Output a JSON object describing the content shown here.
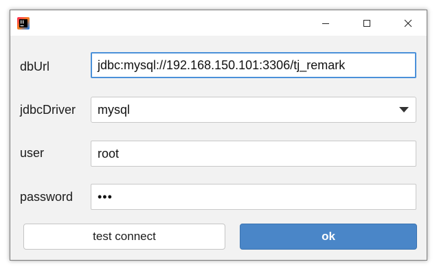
{
  "window": {
    "controls": {
      "minimize_icon": "minimize-icon",
      "maximize_icon": "maximize-icon",
      "close_icon": "close-icon"
    }
  },
  "form": {
    "dburl": {
      "label": "dbUrl",
      "value": "jdbc:mysql://192.168.150.101:3306/tj_remark"
    },
    "driver": {
      "label": "jdbcDriver",
      "value": "mysql"
    },
    "user": {
      "label": "user",
      "value": "root"
    },
    "password": {
      "label": "password",
      "value": "•••"
    }
  },
  "buttons": {
    "test_connect": "test connect",
    "ok": "ok"
  },
  "colors": {
    "accent": "#4a86c8",
    "focus_border": "#4a90d9",
    "window_bg": "#f2f2f2"
  }
}
